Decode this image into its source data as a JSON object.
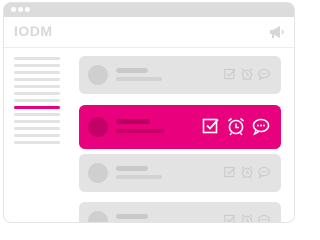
{
  "app": {
    "logo_text": "IODM"
  },
  "sidebar": {
    "items": [
      {
        "active": false
      },
      {
        "active": false
      },
      {
        "active": false
      },
      {
        "active": false
      },
      {
        "active": false
      },
      {
        "active": false
      },
      {
        "active": false
      },
      {
        "active": true
      },
      {
        "active": false
      },
      {
        "active": false
      },
      {
        "active": false
      },
      {
        "active": false
      },
      {
        "active": false
      }
    ]
  },
  "cards": [
    {
      "active": false,
      "icons": [
        "checkbox-icon",
        "alarm-clock-icon",
        "chat-bubble-icon"
      ]
    },
    {
      "active": true,
      "icons": [
        "checkbox-icon",
        "alarm-clock-icon",
        "chat-bubble-icon"
      ]
    },
    {
      "active": false,
      "icons": [
        "checkbox-icon",
        "alarm-clock-icon",
        "chat-bubble-icon"
      ]
    },
    {
      "active": false,
      "icons": [
        "checkbox-icon",
        "alarm-clock-icon",
        "chat-bubble-icon"
      ]
    }
  ],
  "colors": {
    "accent": "#e8007d",
    "muted": "#e3e3e3"
  },
  "icons": {
    "header_right": "megaphone-icon"
  }
}
